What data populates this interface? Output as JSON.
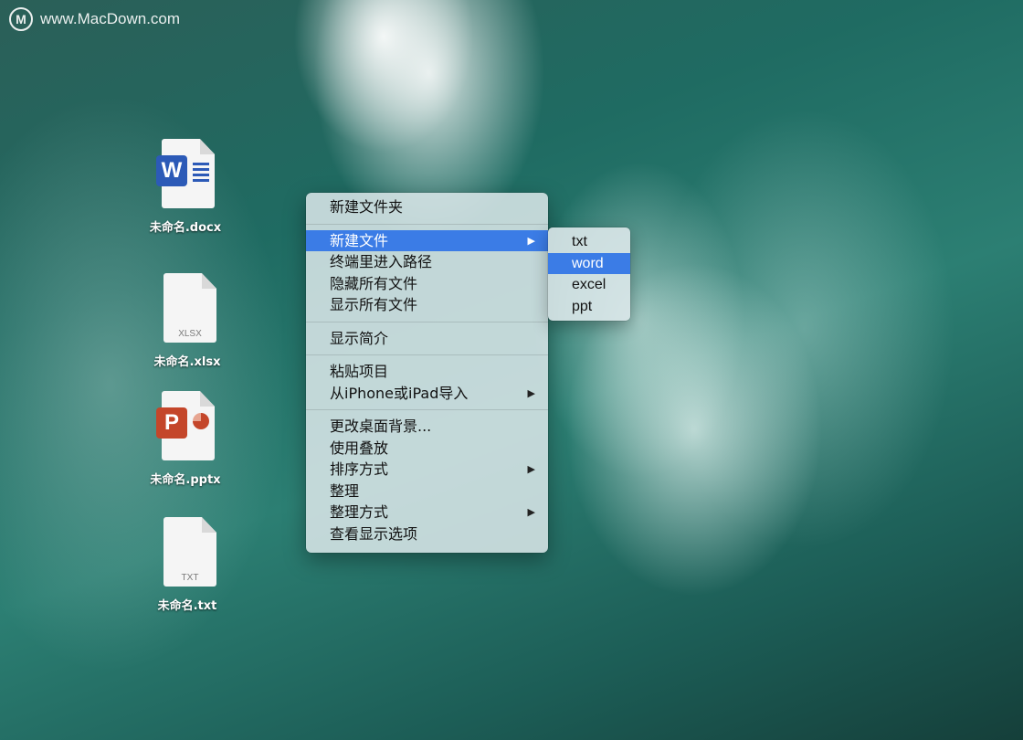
{
  "watermark": {
    "logo": "M",
    "text": "www.MacDown.com"
  },
  "desktop": {
    "files": [
      {
        "label": "未命名.docx",
        "type": "word",
        "badge": "W"
      },
      {
        "label": "未命名.xlsx",
        "type": "xlsx",
        "ext": "XLSX"
      },
      {
        "label": "未命名.pptx",
        "type": "ppt",
        "badge": "P"
      },
      {
        "label": "未命名.txt",
        "type": "txt",
        "ext": "TXT"
      }
    ]
  },
  "context_menu": {
    "items": [
      {
        "label": "新建文件夹"
      },
      {
        "label": "新建文件",
        "submenu": true,
        "active": true
      },
      {
        "label": "终端里进入路径"
      },
      {
        "label": "隐藏所有文件"
      },
      {
        "label": "显示所有文件"
      },
      {
        "label": "显示简介"
      },
      {
        "label": "粘贴项目"
      },
      {
        "label": "从iPhone或iPad导入",
        "submenu": true
      },
      {
        "label": "更改桌面背景..."
      },
      {
        "label": "使用叠放"
      },
      {
        "label": "排序方式",
        "submenu": true
      },
      {
        "label": "整理"
      },
      {
        "label": "整理方式",
        "submenu": true
      },
      {
        "label": "查看显示选项"
      }
    ],
    "arrow_glyph": "▶"
  },
  "submenu": {
    "items": [
      {
        "label": "txt"
      },
      {
        "label": "word",
        "active": true
      },
      {
        "label": "excel"
      },
      {
        "label": "ppt"
      }
    ]
  },
  "colors": {
    "highlight": "#3b7ce6",
    "word": "#2c5ab7",
    "ppt": "#c4462a"
  }
}
